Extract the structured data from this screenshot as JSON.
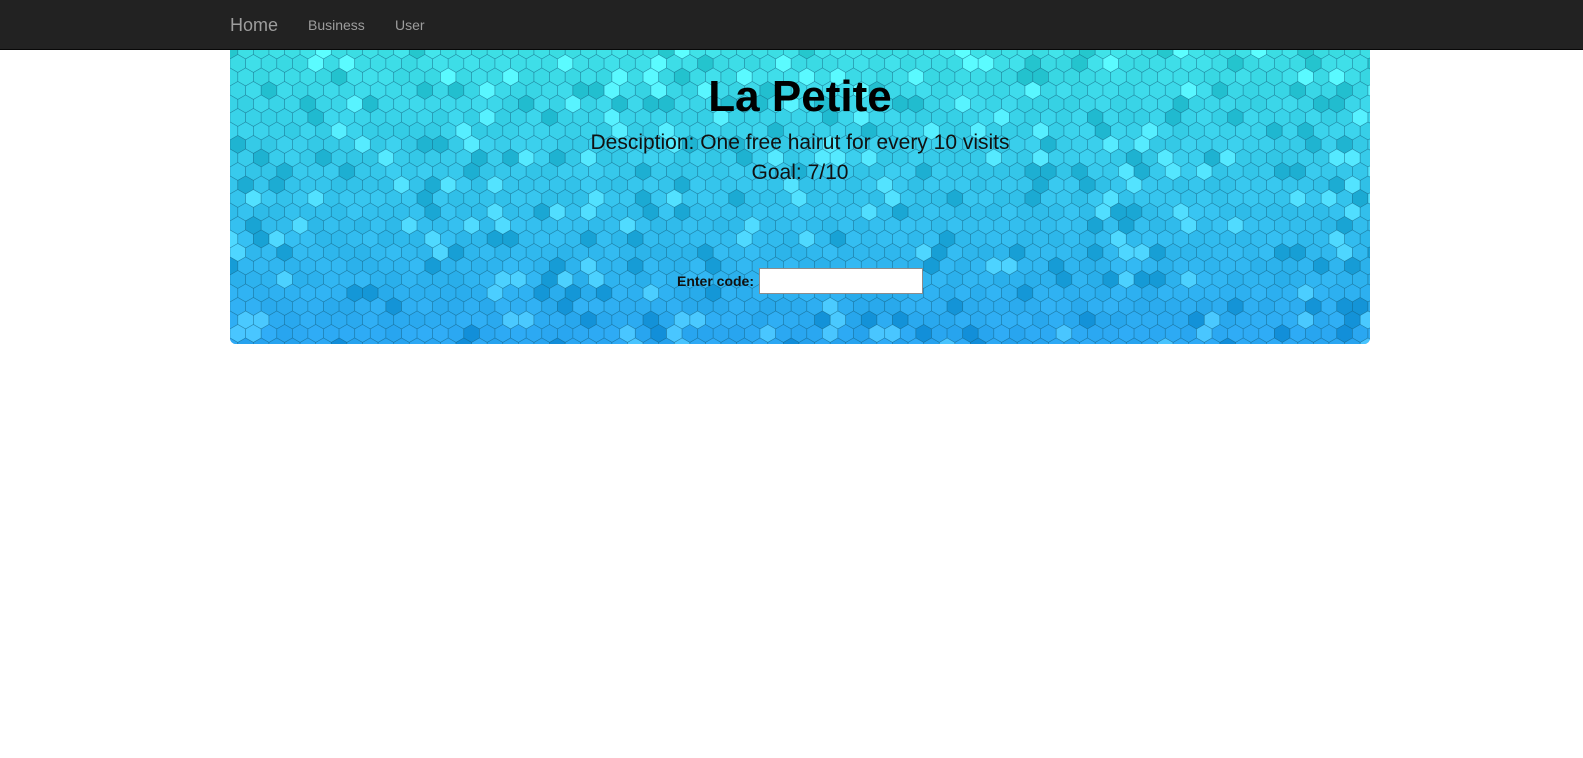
{
  "navbar": {
    "brand": "Home",
    "links": [
      "Business",
      "User"
    ],
    "background": "#222222",
    "link_color": "#9d9d9d"
  },
  "hero": {
    "title": "La Petite",
    "description": "Desciption: One free hairut for every 10 visits",
    "goal": "Goal: 7/10",
    "code_label": "Enter code:",
    "code_value": "",
    "colors": {
      "top": "#3ee0e6",
      "middle": "#3cc8ef",
      "bottom": "#2aa6f2"
    }
  }
}
